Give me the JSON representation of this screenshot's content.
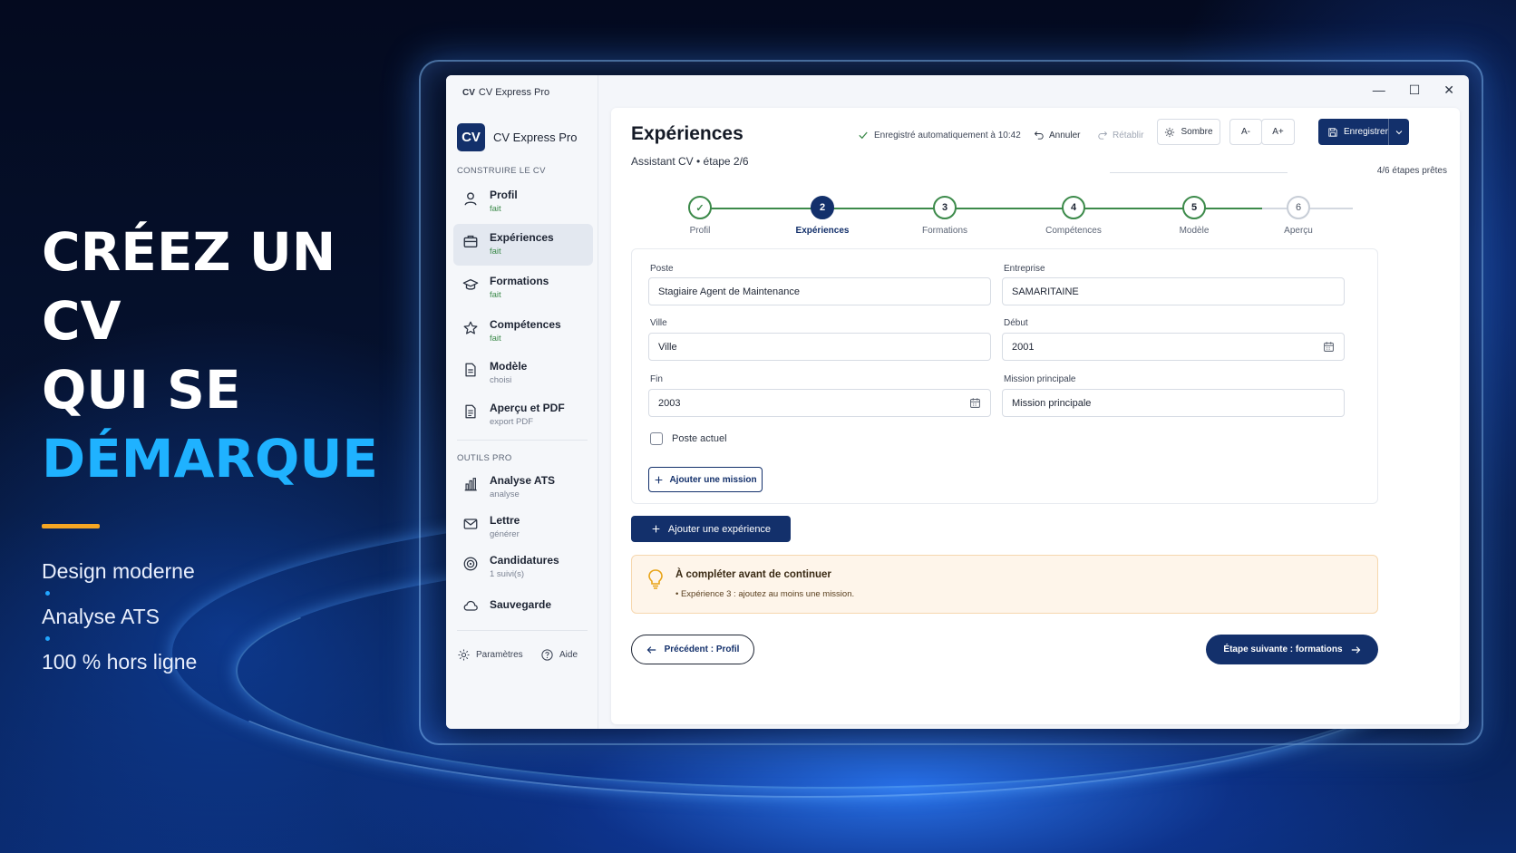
{
  "hero": {
    "line1": "CRÉEZ UN CV",
    "line2": "QUI SE",
    "line3": "DÉMARQUE",
    "features": [
      "Design moderne",
      "Analyse ATS",
      "100 % hors ligne"
    ],
    "accent_color": "#1fb2ff",
    "bar_color": "#f5a623"
  },
  "window": {
    "title": "CV Express Pro",
    "title_mini": "CV",
    "controls": [
      "—",
      "☐",
      "✕"
    ]
  },
  "sidebar": {
    "logo": "CV",
    "brand": "CV Express Pro",
    "section_build": "CONSTRUIRE LE CV",
    "items": [
      {
        "label": "Profil",
        "sub": "fait",
        "icon": "user-icon"
      },
      {
        "label": "Expériences",
        "sub": "fait",
        "icon": "briefcase-icon"
      },
      {
        "label": "Formations",
        "sub": "fait",
        "icon": "graduation-cap-icon"
      },
      {
        "label": "Compétences",
        "sub": "fait",
        "icon": "star-icon"
      },
      {
        "label": "Modèle",
        "sub": "choisi",
        "icon": "document-icon"
      },
      {
        "label": "Aperçu et PDF",
        "sub": "export PDF",
        "icon": "pdf-icon"
      }
    ],
    "section_tools": "OUTILS PRO",
    "tools": [
      {
        "label": "Analyse ATS",
        "sub": "analyse",
        "icon": "chart-icon"
      },
      {
        "label": "Lettre",
        "sub": "générer",
        "icon": "mail-icon"
      },
      {
        "label": "Candidatures",
        "sub": "1 suivi(s)",
        "icon": "target-icon"
      },
      {
        "label": "Sauvegarde",
        "sub": "",
        "icon": "cloud-icon"
      }
    ],
    "settings": "Paramètres",
    "help": "Aide"
  },
  "header": {
    "title": "Expériences",
    "subtitle": "Assistant CV • étape 2/6",
    "autosave": "Enregistré automatiquement à 10:42",
    "undo": "Annuler",
    "redo": "Rétablir",
    "theme": "Sombre",
    "font_minus": "A-",
    "font_plus": "A+",
    "save": "Enregistrer",
    "progress": "4/6 étapes prêtes"
  },
  "stepper": {
    "steps": [
      {
        "num": "✓",
        "label": "Profil",
        "state": "done"
      },
      {
        "num": "2",
        "label": "Expériences",
        "state": "current"
      },
      {
        "num": "3",
        "label": "Formations",
        "state": "done"
      },
      {
        "num": "4",
        "label": "Compétences",
        "state": "done"
      },
      {
        "num": "5",
        "label": "Modèle",
        "state": "done"
      },
      {
        "num": "6",
        "label": "Aperçu",
        "state": "todo"
      }
    ],
    "done_color": "#3c8a4a",
    "current_color": "#13306b"
  },
  "form": {
    "poste_label": "Poste",
    "poste_value": "Stagiaire Agent de Maintenance",
    "entreprise_label": "Entreprise",
    "entreprise_value": "SAMARITAINE",
    "ville_label": "Ville",
    "ville_value": "Ville",
    "debut_label": "Début",
    "debut_value": "2001",
    "fin_label": "Fin",
    "fin_value": "2003",
    "mission_label": "Mission principale",
    "mission_value": "Mission principale",
    "poste_actuel": "Poste actuel",
    "add_mission": "Ajouter une mission"
  },
  "add_experience": "Ajouter une expérience",
  "alert": {
    "title": "À compléter avant de continuer",
    "text": "• Expérience 3 : ajoutez au moins une mission."
  },
  "nav": {
    "prev": "Précédent : Profil",
    "next": "Étape suivante : formations"
  },
  "colors": {
    "primary": "#13306b",
    "success": "#3c8a4a",
    "warning_bg": "#fef5ea"
  }
}
